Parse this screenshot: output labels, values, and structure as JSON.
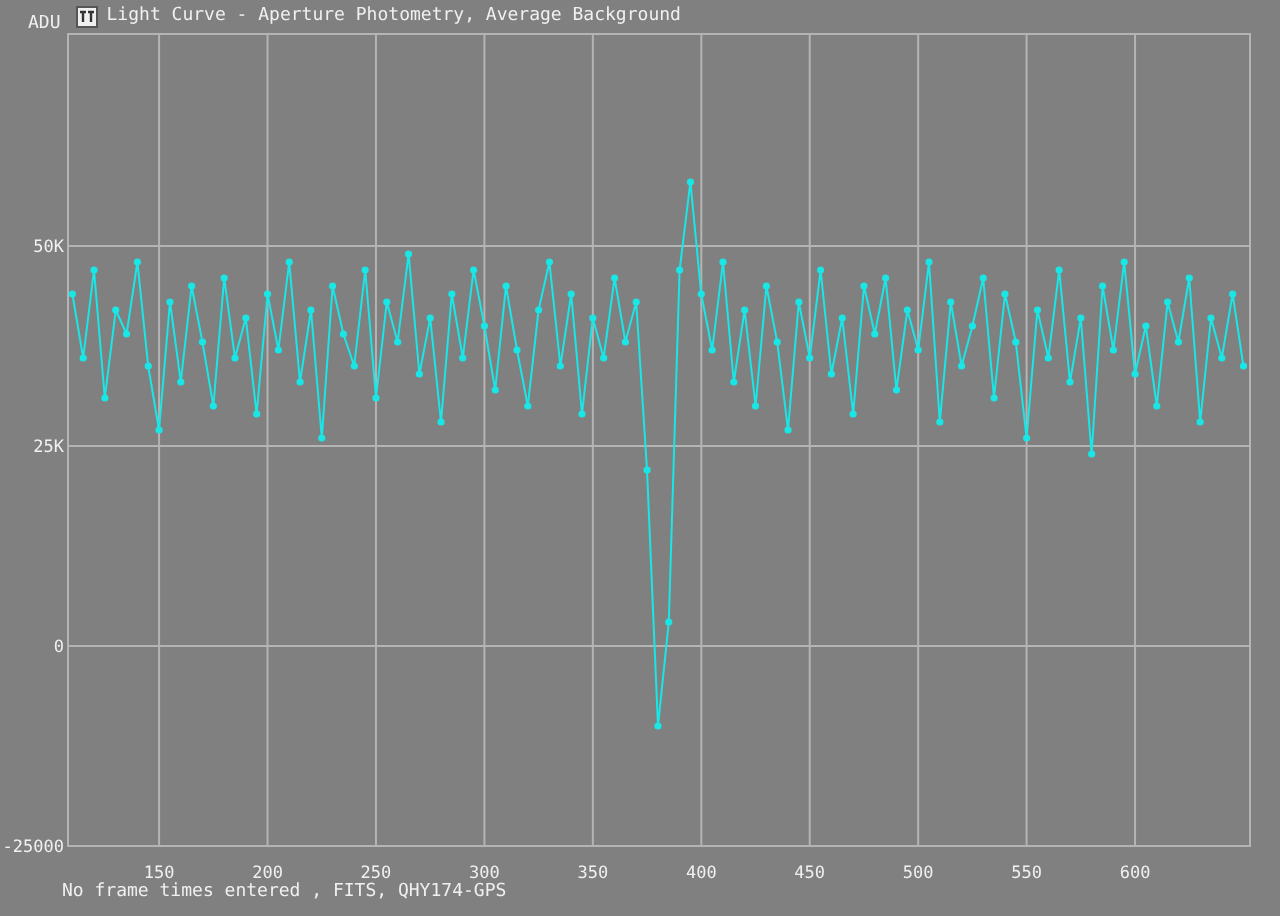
{
  "window": {
    "title": "Light Curve - Aperture Photometry, Average Background"
  },
  "chart_data": {
    "type": "line",
    "ylabel": "ADU",
    "x": [
      110,
      115,
      120,
      125,
      130,
      135,
      140,
      145,
      150,
      155,
      160,
      165,
      170,
      175,
      180,
      185,
      190,
      195,
      200,
      205,
      210,
      215,
      220,
      225,
      230,
      235,
      240,
      245,
      250,
      255,
      260,
      265,
      270,
      275,
      280,
      285,
      290,
      295,
      300,
      305,
      310,
      315,
      320,
      325,
      330,
      335,
      340,
      345,
      350,
      355,
      360,
      365,
      370,
      375,
      380,
      385,
      390,
      395,
      400,
      405,
      410,
      415,
      420,
      425,
      430,
      435,
      440,
      445,
      450,
      455,
      460,
      465,
      470,
      475,
      480,
      485,
      490,
      495,
      500,
      505,
      510,
      515,
      520,
      525,
      530,
      535,
      540,
      545,
      550,
      555,
      560,
      565,
      570,
      575,
      580,
      585,
      590,
      595,
      600,
      605,
      610,
      615,
      620,
      625,
      630,
      635,
      640,
      645,
      650
    ],
    "grid": true,
    "series": [
      {
        "color": "#19e6e6",
        "marker": "circle",
        "values": [
          44000,
          36000,
          47000,
          31000,
          42000,
          39000,
          48000,
          35000,
          27000,
          43000,
          33000,
          45000,
          38000,
          30000,
          46000,
          36000,
          41000,
          29000,
          44000,
          37000,
          48000,
          33000,
          42000,
          26000,
          45000,
          39000,
          35000,
          47000,
          31000,
          43000,
          38000,
          49000,
          34000,
          41000,
          28000,
          44000,
          36000,
          47000,
          40000,
          32000,
          45000,
          37000,
          30000,
          42000,
          48000,
          35000,
          44000,
          29000,
          41000,
          36000,
          46000,
          38000,
          43000,
          22000,
          -10000,
          3000,
          47000,
          58000,
          44000,
          37000,
          48000,
          33000,
          42000,
          30000,
          45000,
          38000,
          27000,
          43000,
          36000,
          47000,
          34000,
          41000,
          29000,
          45000,
          39000,
          46000,
          32000,
          42000,
          37000,
          48000,
          28000,
          43000,
          35000,
          40000,
          46000,
          31000,
          44000,
          38000,
          26000,
          42000,
          36000,
          47000,
          33000,
          41000,
          24000,
          45000,
          37000,
          48000,
          34000,
          40000,
          30000,
          43000,
          38000,
          46000,
          28000,
          41000,
          36000,
          44000,
          35000
        ]
      }
    ],
    "xlim": [
      108,
      653
    ],
    "ylim": [
      -25000,
      76500
    ],
    "xticks": [
      150,
      200,
      250,
      300,
      350,
      400,
      450,
      500,
      550,
      600
    ],
    "yticks": [
      {
        "value": -25000,
        "label": "-25000"
      },
      {
        "value": 0,
        "label": "0"
      },
      {
        "value": 25000,
        "label": "25K"
      },
      {
        "value": 50000,
        "label": "50K"
      }
    ]
  },
  "status_bar": "No frame times entered , FITS, QHY174-GPS"
}
